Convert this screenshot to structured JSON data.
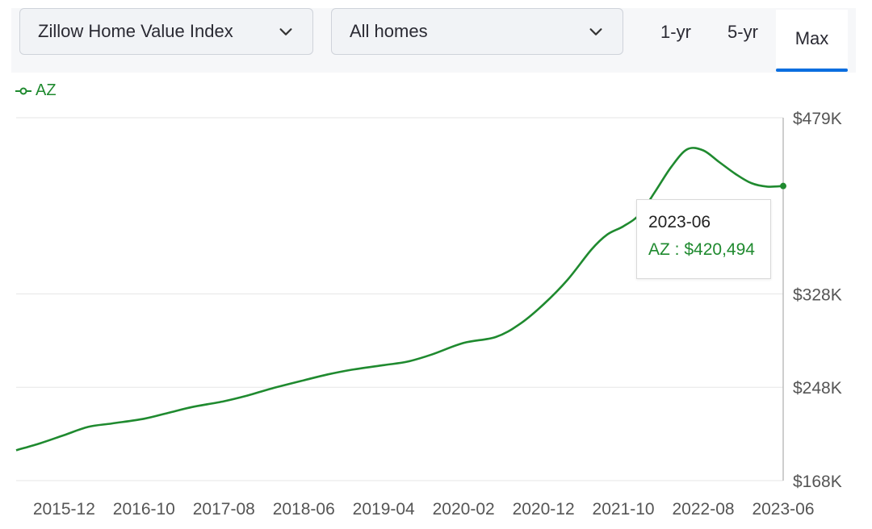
{
  "controls": {
    "metric_select": "Zillow Home Value Index",
    "home_type_select": "All homes",
    "ranges": [
      "1-yr",
      "5-yr",
      "Max"
    ],
    "active_range": "Max",
    "chevron_icon": "chevron-down-icon"
  },
  "colors": {
    "series": "#1f8a2f",
    "accent": "#0a6ee0",
    "grid": "#e6e6e6",
    "axis_text": "#555555"
  },
  "tooltip": {
    "date": "2023-06",
    "series": "AZ",
    "separator": " : ",
    "value_text": "$420,494"
  },
  "chart_data": {
    "type": "line",
    "legend_position": "top-left",
    "grid": true,
    "y_axis_position": "right",
    "ylim": [
      168000,
      479000
    ],
    "y_ticks": [
      {
        "value": 479000,
        "label": "$479K"
      },
      {
        "value": 328000,
        "label": "$328K"
      },
      {
        "value": 248000,
        "label": "$248K"
      },
      {
        "value": 168000,
        "label": "$168K"
      }
    ],
    "x_tick_labels": [
      "2015-12",
      "2016-10",
      "2017-08",
      "2018-06",
      "2019-04",
      "2020-02",
      "2020-12",
      "2021-10",
      "2022-08",
      "2023-06"
    ],
    "series": [
      {
        "name": "AZ",
        "x": [
          "2015-06",
          "2015-09",
          "2015-12",
          "2016-03",
          "2016-06",
          "2016-10",
          "2017-01",
          "2017-04",
          "2017-08",
          "2017-11",
          "2018-02",
          "2018-06",
          "2018-09",
          "2018-12",
          "2019-04",
          "2019-07",
          "2019-10",
          "2020-02",
          "2020-06",
          "2020-09",
          "2020-12",
          "2021-03",
          "2021-06",
          "2021-08",
          "2021-10",
          "2021-12",
          "2022-02",
          "2022-04",
          "2022-06",
          "2022-08",
          "2022-10",
          "2022-12",
          "2023-02",
          "2023-04",
          "2023-06"
        ],
        "values": [
          194000,
          200000,
          207000,
          214000,
          217000,
          221000,
          226000,
          231000,
          236000,
          241000,
          247000,
          254000,
          259000,
          263000,
          267000,
          270000,
          276000,
          286000,
          291000,
          302000,
          319000,
          340000,
          366000,
          379000,
          386000,
          396000,
          416000,
          437000,
          452000,
          451000,
          441000,
          431000,
          423000,
          420000,
          420494
        ]
      }
    ]
  }
}
